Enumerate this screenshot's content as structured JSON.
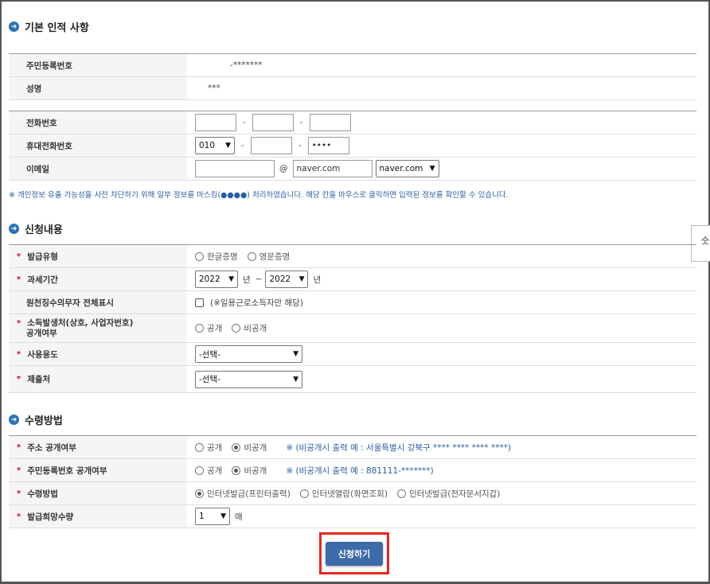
{
  "sections": {
    "basic": "기본 인적 사항",
    "apply": "신청내용",
    "receive": "수령방법"
  },
  "basic": {
    "rrn_label": "주민등록번호",
    "rrn_value": "-*******",
    "name_label": "성명",
    "name_value": "***",
    "phone_label": "전화번호",
    "mobile_label": "휴대전화번호",
    "mobile_prefix": "010",
    "mobile_last": "••••",
    "email_label": "이메일",
    "email_at": "@",
    "email_domain": "naver.com",
    "email_domain_select": "naver.com"
  },
  "notice": "※ 개인정보 유출 가능성을 사전 차단하기 위해 일부 정보를 마스킹(●●●●) 처리하였습니다. 해당 칸을 마우스로 클릭하면 입력된 정보를 확인할 수 있습니다.",
  "apply": {
    "type_label": "발급유형",
    "type_opt1": "한글증명",
    "type_opt2": "영문증명",
    "period_label": "과세기간",
    "period_from": "2022",
    "period_year1": "년",
    "period_tilde": "~",
    "period_to": "2022",
    "period_year2": "년",
    "withhold_label": "원천징수의무자 전체표시",
    "withhold_note": "(※일용근로소득자만 해당)",
    "income_label_1": "소득발생처(상호, 사업자번호)",
    "income_label_2": "공개여부",
    "income_opt1": "공개",
    "income_opt2": "비공개",
    "purpose_label": "사용용도",
    "purpose_value": "-선택-",
    "submit_to_label": "제출처",
    "submit_to_value": "-선택-"
  },
  "receive": {
    "addr_label": "주소 공개여부",
    "addr_opt1": "공개",
    "addr_opt2": "비공개",
    "addr_note": "※ (비공개시 출력 예 : 서울특별시 강북구 **** **** **** ****)",
    "rrn_label": "주민등록번호 공개여부",
    "rrn_opt1": "공개",
    "rrn_opt2": "비공개",
    "rrn_note": "※ (비공개시 출력 예 : 881111-*******)",
    "method_label": "수령방법",
    "method_opt1": "인터넷발급(프린터출력)",
    "method_opt2": "인터넷열람(화면조회)",
    "method_opt3": "인터넷발급(전자문서지갑)",
    "qty_label": "발급희망수량",
    "qty_value": "1",
    "qty_unit": "매"
  },
  "side_tab": "숫",
  "submit_label": "신청하기",
  "colors": {
    "accent": "#3d6aa8",
    "required": "#c8102e",
    "highlight": "#e8261c"
  }
}
